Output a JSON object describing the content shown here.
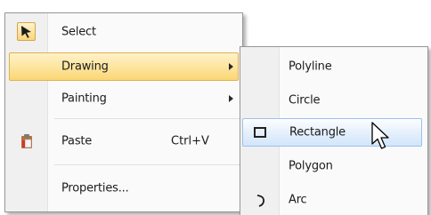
{
  "context_menu": {
    "items": [
      {
        "label": "Select",
        "icon": "select-arrow-icon"
      },
      {
        "label": "Drawing",
        "has_submenu": true,
        "highlighted": true
      },
      {
        "label": "Painting",
        "has_submenu": true
      },
      {
        "label": "Paste",
        "shortcut": "Ctrl+V",
        "icon": "clipboard-paste-icon"
      },
      {
        "label": "Properties..."
      }
    ]
  },
  "drawing_submenu": {
    "items": [
      {
        "label": "Polyline"
      },
      {
        "label": "Circle"
      },
      {
        "label": "Rectangle",
        "icon": "rectangle-icon",
        "hovered": true
      },
      {
        "label": "Polygon"
      },
      {
        "label": "Arc",
        "icon": "arc-icon"
      }
    ]
  },
  "colors": {
    "highlight": "#fbd675",
    "hover": "#d2e6fb",
    "menu_border": "#979797"
  }
}
